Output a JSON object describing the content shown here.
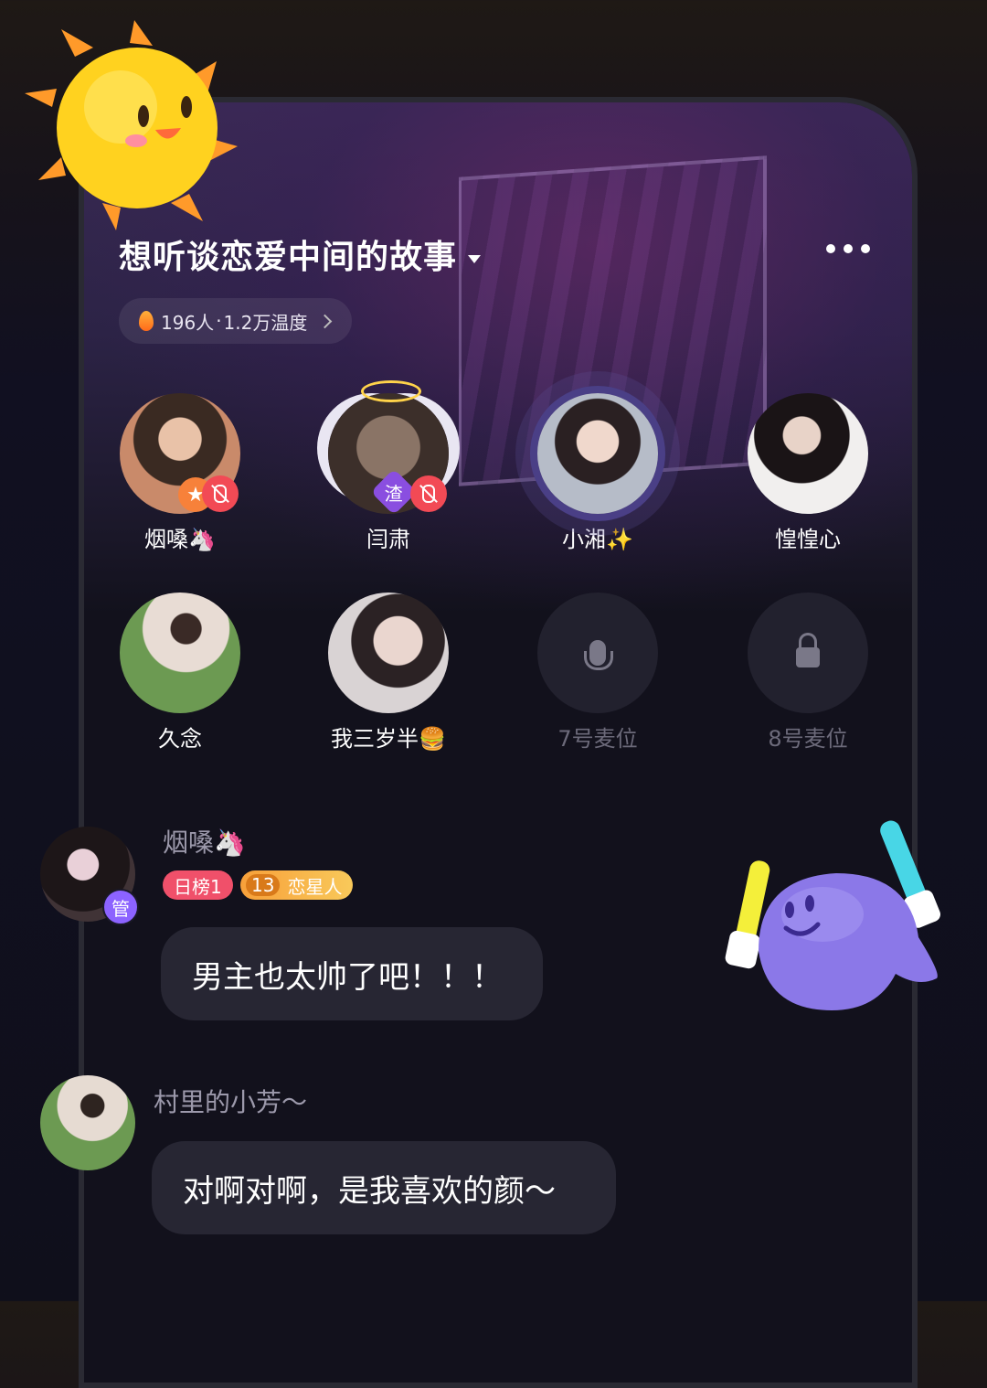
{
  "room": {
    "title": "想听谈恋爱中间的故事",
    "stats_count": "196人",
    "stats_sep": "·",
    "stats_heat": "1.2万温度"
  },
  "seats": [
    {
      "name": "烟嗓🦄",
      "muted": true
    },
    {
      "name": "闫肃",
      "muted": true,
      "badge": "渣"
    },
    {
      "name": "小湘✨",
      "speaking": true
    },
    {
      "name": "惶惶心"
    },
    {
      "name": "久念"
    },
    {
      "name": "我三岁半🍔"
    },
    {
      "name": "7号麦位",
      "empty": true,
      "icon": "mic-icon"
    },
    {
      "name": "8号麦位",
      "empty": true,
      "icon": "lock-icon"
    }
  ],
  "messages": [
    {
      "user": "烟嗓🦄",
      "admin_badge": "管",
      "rank_badge": "日榜1",
      "level": "13",
      "level_title": "恋星人",
      "text": "男主也太帅了吧！！！"
    },
    {
      "user": "村里的小芳～",
      "text": "对啊对啊，是我喜欢的颜～"
    }
  ],
  "colors": {
    "accent_purple": "#8c63ff",
    "mute_red": "#f24a55",
    "rank_pink": "#f0506a",
    "level_orange": "#f7a03a"
  }
}
